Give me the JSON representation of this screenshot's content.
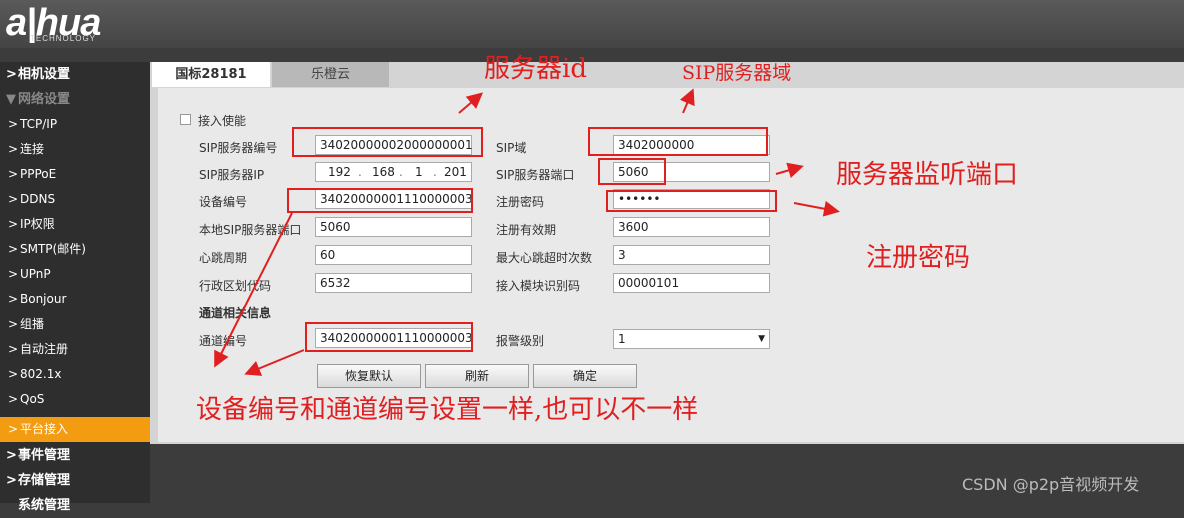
{
  "brand": {
    "logo": "a|hua",
    "sub": "TECHNOLOGY"
  },
  "sidebar": {
    "items": [
      {
        "label": "相机设置",
        "arrow": ">"
      },
      {
        "label": "网络设置",
        "arrow": "▼"
      },
      {
        "label": "TCP/IP",
        "arrow": ">"
      },
      {
        "label": "连接",
        "arrow": ">"
      },
      {
        "label": "PPPoE",
        "arrow": ">"
      },
      {
        "label": "DDNS",
        "arrow": ">"
      },
      {
        "label": "IP权限",
        "arrow": ">"
      },
      {
        "label": "SMTP(邮件)",
        "arrow": ">"
      },
      {
        "label": "UPnP",
        "arrow": ">"
      },
      {
        "label": "Bonjour",
        "arrow": ">"
      },
      {
        "label": "组播",
        "arrow": ">"
      },
      {
        "label": "自动注册",
        "arrow": ">"
      },
      {
        "label": "802.1x",
        "arrow": ">"
      },
      {
        "label": "QoS",
        "arrow": ">"
      },
      {
        "label": "平台接入",
        "arrow": ">"
      },
      {
        "label": "事件管理",
        "arrow": ">"
      },
      {
        "label": "存储管理",
        "arrow": ">"
      },
      {
        "label": "系统管理",
        "arrow": ""
      }
    ]
  },
  "tabs": [
    {
      "label": "国标28181"
    },
    {
      "label": "乐橙云"
    }
  ],
  "form": {
    "enable_label": "接入使能",
    "sip_server_id_label": "SIP服务器编号",
    "sip_server_id": "34020000002000000001",
    "sip_domain_label": "SIP域",
    "sip_domain": "3402000000",
    "sip_server_ip_label": "SIP服务器IP",
    "ip": [
      "192",
      "168",
      "1",
      "201"
    ],
    "sip_server_port_label": "SIP服务器端口",
    "sip_server_port": "5060",
    "device_id_label": "设备编号",
    "device_id": "34020000001110000003",
    "reg_password_label": "注册密码",
    "reg_password": "••••••",
    "local_sip_port_label": "本地SIP服务器端口",
    "local_sip_port": "5060",
    "reg_validity_label": "注册有效期",
    "reg_validity": "3600",
    "heartbeat_label": "心跳周期",
    "heartbeat": "60",
    "max_heartbeat_label": "最大心跳超时次数",
    "max_heartbeat": "3",
    "region_code_label": "行政区划代码",
    "region_code": "6532",
    "module_id_label": "接入模块识别码",
    "module_id": "00000101",
    "channel_section_label": "通道相关信息",
    "channel_id_label": "通道编号",
    "channel_id": "34020000001110000003",
    "alarm_level_label": "报警级别",
    "alarm_level": "1"
  },
  "buttons": {
    "restore": "恢复默认",
    "refresh": "刷新",
    "ok": "确定"
  },
  "annotations": {
    "server_id": "服务器id",
    "sip_domain": "SIP服务器域",
    "listen_port": "服务器监听端口",
    "password": "注册密码",
    "channel_note": "设备编号和通道编号设置一样,也可以不一样"
  },
  "watermark": "CSDN @p2p音视频开发",
  "colors": {
    "accent": "#f39c12",
    "annotation": "#e02020"
  }
}
